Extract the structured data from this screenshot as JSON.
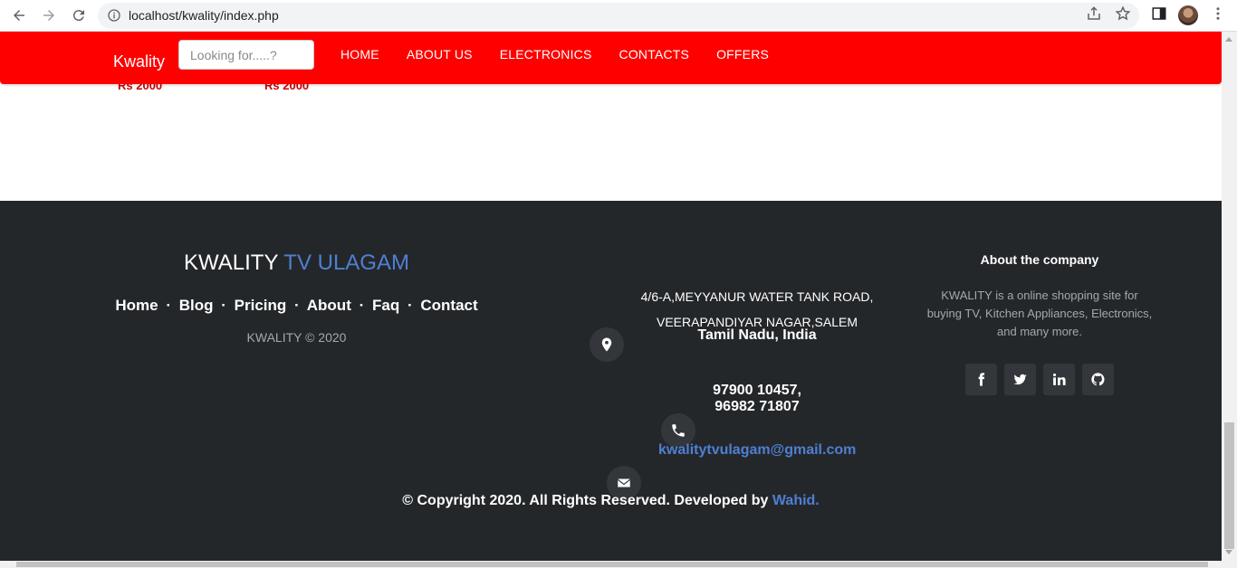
{
  "browser": {
    "url": "localhost/kwality/index.php"
  },
  "navbar": {
    "brand": "Kwality",
    "search_placeholder": "Looking for.....?",
    "menu": [
      "HOME",
      "ABOUT US",
      "ELECTRONICS",
      "CONTACTS",
      "OFFERS"
    ]
  },
  "products_partial": {
    "prices": [
      "Rs 2000",
      "Rs 2000"
    ]
  },
  "footer": {
    "brand_main": "KWALITY",
    "brand_accent": "TV ULAGAM",
    "links": [
      "Home",
      "Blog",
      "Pricing",
      "About",
      "Faq",
      "Contact"
    ],
    "link_separator": "·",
    "copyright_small": "KWALITY © 2020",
    "address_line1": "4/6-A,MEYYANUR WATER TANK ROAD,",
    "address_line2": "VEERAPANDIYAR NAGAR,SALEM",
    "address_line3": "Tamil Nadu, India",
    "phone_line1": "97900 10457,",
    "phone_line2": "96982 71807",
    "email": "kwalitytvulagam@gmail.com",
    "about_title": "About the company",
    "about_text": "KWALITY is a online shopping site for buying TV, Kitchen Appliances, Electronics, and many more.",
    "socials": [
      "facebook-icon",
      "twitter-icon",
      "linkedin-icon",
      "github-icon"
    ],
    "bottom_copy": "© Copyright 2020. All Rights Reserved. Developed by",
    "developer": "Wahid."
  },
  "colors": {
    "navbar_bg": "#ff0000",
    "footer_bg": "#24272a",
    "accent_blue": "#4f7fd3"
  }
}
